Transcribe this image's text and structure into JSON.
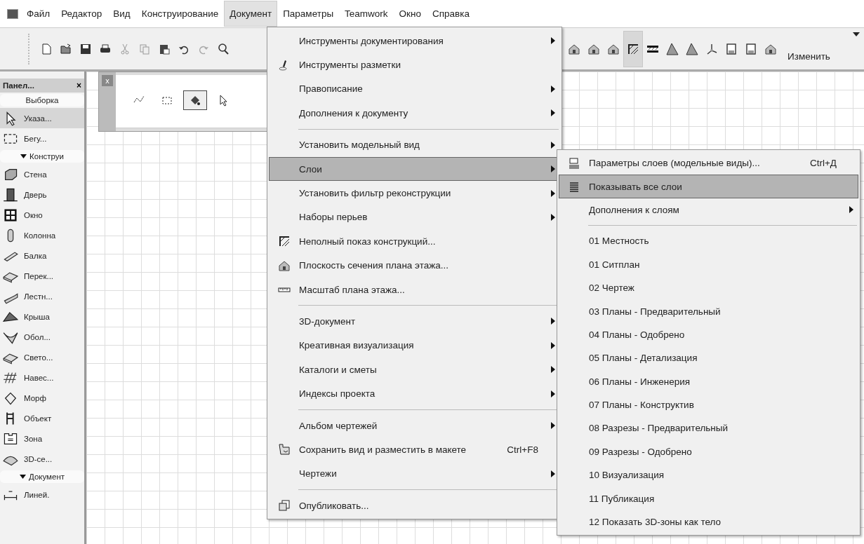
{
  "menubar": {
    "items": [
      {
        "label": "Файл",
        "selected": false
      },
      {
        "label": "Редактор",
        "selected": false
      },
      {
        "label": "Вид",
        "selected": false
      },
      {
        "label": "Конструирование",
        "selected": false
      },
      {
        "label": "Документ",
        "selected": true
      },
      {
        "label": "Параметры",
        "selected": false
      },
      {
        "label": "Teamwork",
        "selected": false
      },
      {
        "label": "Окно",
        "selected": false
      },
      {
        "label": "Справка",
        "selected": false
      }
    ]
  },
  "toolbar": {
    "left_buttons": [
      {
        "kind": "new"
      },
      {
        "kind": "open"
      },
      {
        "kind": "save"
      },
      {
        "kind": "print"
      },
      {
        "kind": "cut"
      },
      {
        "kind": "copy"
      },
      {
        "kind": "paste"
      },
      {
        "kind": "undo"
      },
      {
        "kind": "redo"
      },
      {
        "kind": "zoom"
      }
    ],
    "right_buttons": [
      {
        "kind": "house",
        "selected": false
      },
      {
        "kind": "house",
        "selected": false
      },
      {
        "kind": "house",
        "selected": false
      },
      {
        "kind": "hatch",
        "selected": true
      },
      {
        "kind": "stripes",
        "selected": false
      },
      {
        "kind": "plane",
        "selected": false
      },
      {
        "kind": "plane",
        "selected": false
      },
      {
        "kind": "axes",
        "selected": false
      },
      {
        "kind": "sheet",
        "selected": false
      },
      {
        "kind": "sheet",
        "selected": false
      },
      {
        "kind": "house",
        "selected": false
      }
    ],
    "label": "Изменить"
  },
  "panel": {
    "title": "Панел...",
    "close": "×",
    "items": [
      {
        "kind": "section",
        "label": "Выборка"
      },
      {
        "kind": "tool",
        "label": "Указа...",
        "selected": true
      },
      {
        "kind": "tool",
        "label": "Бегу...",
        "selected": false
      },
      {
        "kind": "section",
        "label": "Конструи"
      },
      {
        "kind": "tool",
        "label": "Стена",
        "selected": false
      },
      {
        "kind": "tool",
        "label": "Дверь",
        "selected": false
      },
      {
        "kind": "tool",
        "label": "Окно",
        "selected": false
      },
      {
        "kind": "tool",
        "label": "Колонна",
        "selected": false
      },
      {
        "kind": "tool",
        "label": "Балка",
        "selected": false
      },
      {
        "kind": "tool",
        "label": "Перек...",
        "selected": false
      },
      {
        "kind": "tool",
        "label": "Лестн...",
        "selected": false
      },
      {
        "kind": "tool",
        "label": "Крыша",
        "selected": false
      },
      {
        "kind": "tool",
        "label": "Обол...",
        "selected": false
      },
      {
        "kind": "tool",
        "label": "Свето...",
        "selected": false
      },
      {
        "kind": "tool",
        "label": "Навес...",
        "selected": false
      },
      {
        "kind": "tool",
        "label": "Морф",
        "selected": false
      },
      {
        "kind": "tool",
        "label": "Объект",
        "selected": false
      },
      {
        "kind": "tool",
        "label": "Зона",
        "selected": false
      },
      {
        "kind": "tool",
        "label": "3D-се...",
        "selected": false
      },
      {
        "kind": "section",
        "label": "Документ"
      },
      {
        "kind": "tool",
        "label": "Линей.",
        "selected": false
      }
    ]
  },
  "menu": {
    "items": [
      {
        "kind": "item",
        "label": "Инструменты документирования",
        "submenu": true,
        "selected": false
      },
      {
        "kind": "item",
        "label": "Инструменты разметки",
        "submenu": false,
        "selected": false
      },
      {
        "kind": "item",
        "label": "Правописание",
        "submenu": true,
        "selected": false
      },
      {
        "kind": "item",
        "label": "Дополнения к документу",
        "submenu": true,
        "selected": false
      },
      {
        "kind": "separator"
      },
      {
        "kind": "item",
        "label": "Установить модельный вид",
        "submenu": true,
        "selected": false
      },
      {
        "kind": "item",
        "label": "Слои",
        "submenu": true,
        "selected": true
      },
      {
        "kind": "item",
        "label": "Установить фильтр реконструкции",
        "submenu": true,
        "selected": false
      },
      {
        "kind": "item",
        "label": "Наборы перьев",
        "submenu": true,
        "selected": false
      },
      {
        "kind": "item",
        "label": "Неполный показ конструкций...",
        "submenu": false,
        "selected": false
      },
      {
        "kind": "item",
        "label": "Плоскость сечения плана этажа...",
        "submenu": false,
        "selected": false
      },
      {
        "kind": "item",
        "label": "Масштаб плана этажа...",
        "submenu": false,
        "selected": false
      },
      {
        "kind": "separator"
      },
      {
        "kind": "item",
        "label": "3D-документ",
        "submenu": true,
        "selected": false
      },
      {
        "kind": "item",
        "label": "Креативная визуализация",
        "submenu": true,
        "selected": false
      },
      {
        "kind": "item",
        "label": "Каталоги и сметы",
        "submenu": true,
        "selected": false
      },
      {
        "kind": "item",
        "label": "Индексы проекта",
        "submenu": true,
        "selected": false
      },
      {
        "kind": "separator"
      },
      {
        "kind": "item",
        "label": "Альбом чертежей",
        "submenu": true,
        "selected": false
      },
      {
        "kind": "item",
        "label": "Сохранить вид и разместить в макете",
        "shortcut": "Ctrl+F8",
        "submenu": false,
        "selected": false
      },
      {
        "kind": "item",
        "label": "Чертежи",
        "submenu": true,
        "selected": false
      },
      {
        "kind": "separator"
      },
      {
        "kind": "item",
        "label": "Опубликовать...",
        "submenu": false,
        "selected": false
      }
    ]
  },
  "submenu": {
    "items": [
      {
        "kind": "item",
        "label": "Параметры слоев (модельные виды)...",
        "shortcut": "Ctrl+Д",
        "submenu": false,
        "selected": false
      },
      {
        "kind": "item",
        "label": "Показывать все слои",
        "submenu": false,
        "selected": true
      },
      {
        "kind": "item",
        "label": "Дополнения к слоям",
        "submenu": true,
        "selected": false
      },
      {
        "kind": "separator"
      },
      {
        "kind": "item",
        "label": "01 Местность",
        "submenu": false,
        "selected": false
      },
      {
        "kind": "item",
        "label": "01 Ситплан",
        "submenu": false,
        "selected": false
      },
      {
        "kind": "item",
        "label": "02 Чертеж",
        "submenu": false,
        "selected": false
      },
      {
        "kind": "item",
        "label": "03 Планы - Предварительный",
        "submenu": false,
        "selected": false
      },
      {
        "kind": "item",
        "label": "04 Планы - Одобрено",
        "submenu": false,
        "selected": false
      },
      {
        "kind": "item",
        "label": "05 Планы - Детализация",
        "submenu": false,
        "selected": false
      },
      {
        "kind": "item",
        "label": "06 Планы - Инженерия",
        "submenu": false,
        "selected": false
      },
      {
        "kind": "item",
        "label": "07 Планы - Конструктив",
        "submenu": false,
        "selected": false
      },
      {
        "kind": "item",
        "label": "08 Разрезы - Предварительный",
        "submenu": false,
        "selected": false
      },
      {
        "kind": "item",
        "label": "09 Разрезы - Одобрено",
        "submenu": false,
        "selected": false
      },
      {
        "kind": "item",
        "label": "10 Визуализация",
        "submenu": false,
        "selected": false
      },
      {
        "kind": "item",
        "label": "11 Публикация",
        "submenu": false,
        "selected": false
      },
      {
        "kind": "item",
        "label": "12 Показать 3D-зоны как тело",
        "submenu": false,
        "selected": false
      }
    ]
  },
  "palette": {
    "close": "x",
    "buttons": [
      {
        "kind": "polyline",
        "selected": false
      },
      {
        "kind": "rect",
        "selected": false
      },
      {
        "kind": "fill",
        "selected": true
      },
      {
        "kind": "pointer",
        "selected": false
      }
    ]
  }
}
